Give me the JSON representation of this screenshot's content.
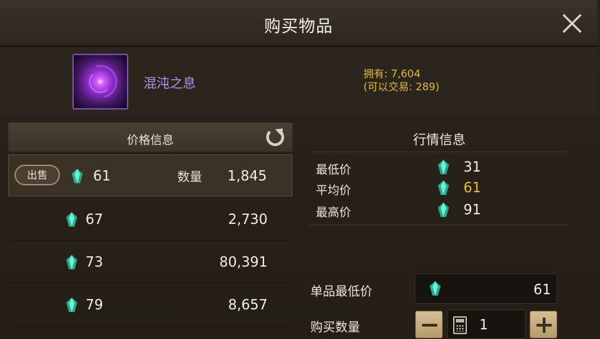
{
  "dialog": {
    "title": "购买物品",
    "close_icon": "close-icon"
  },
  "item": {
    "name": "混沌之息",
    "icon": "chaos-orb-icon",
    "owned_text": "拥有: 7,604",
    "tradable_text": "(可以交易: 289)"
  },
  "price_panel": {
    "header": "价格信息",
    "refresh_icon": "refresh-icon",
    "sell_label": "出售",
    "qty_label": "数量",
    "rows": [
      {
        "price": "61",
        "qty": "1,845"
      },
      {
        "price": "67",
        "qty": "2,730"
      },
      {
        "price": "73",
        "qty": "80,391"
      },
      {
        "price": "79",
        "qty": "8,657"
      }
    ]
  },
  "market": {
    "header": "行情信息",
    "min_label": "最低价",
    "min_value": "31",
    "avg_label": "平均价",
    "avg_value": "61",
    "max_label": "最高价",
    "max_value": "91"
  },
  "purchase": {
    "unit_min_label": "单品最低价",
    "unit_min_value": "61",
    "buy_qty_label": "购买数量",
    "quantity": "1"
  },
  "colors": {
    "gem": "#3fd0b0",
    "avg_price": "#e8b84a",
    "item_name": "#b88cf0",
    "owned": "#e0b84a"
  }
}
